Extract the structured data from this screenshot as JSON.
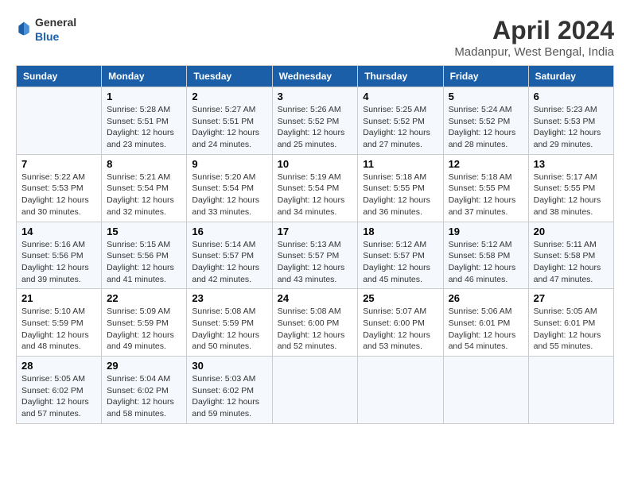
{
  "header": {
    "logo": {
      "text1": "General",
      "text2": "Blue"
    },
    "title": "April 2024",
    "subtitle": "Madanpur, West Bengal, India"
  },
  "calendar": {
    "columns": [
      "Sunday",
      "Monday",
      "Tuesday",
      "Wednesday",
      "Thursday",
      "Friday",
      "Saturday"
    ],
    "weeks": [
      {
        "days": [
          {
            "number": "",
            "info": ""
          },
          {
            "number": "1",
            "info": "Sunrise: 5:28 AM\nSunset: 5:51 PM\nDaylight: 12 hours\nand 23 minutes."
          },
          {
            "number": "2",
            "info": "Sunrise: 5:27 AM\nSunset: 5:51 PM\nDaylight: 12 hours\nand 24 minutes."
          },
          {
            "number": "3",
            "info": "Sunrise: 5:26 AM\nSunset: 5:52 PM\nDaylight: 12 hours\nand 25 minutes."
          },
          {
            "number": "4",
            "info": "Sunrise: 5:25 AM\nSunset: 5:52 PM\nDaylight: 12 hours\nand 27 minutes."
          },
          {
            "number": "5",
            "info": "Sunrise: 5:24 AM\nSunset: 5:52 PM\nDaylight: 12 hours\nand 28 minutes."
          },
          {
            "number": "6",
            "info": "Sunrise: 5:23 AM\nSunset: 5:53 PM\nDaylight: 12 hours\nand 29 minutes."
          }
        ]
      },
      {
        "days": [
          {
            "number": "7",
            "info": "Sunrise: 5:22 AM\nSunset: 5:53 PM\nDaylight: 12 hours\nand 30 minutes."
          },
          {
            "number": "8",
            "info": "Sunrise: 5:21 AM\nSunset: 5:54 PM\nDaylight: 12 hours\nand 32 minutes."
          },
          {
            "number": "9",
            "info": "Sunrise: 5:20 AM\nSunset: 5:54 PM\nDaylight: 12 hours\nand 33 minutes."
          },
          {
            "number": "10",
            "info": "Sunrise: 5:19 AM\nSunset: 5:54 PM\nDaylight: 12 hours\nand 34 minutes."
          },
          {
            "number": "11",
            "info": "Sunrise: 5:18 AM\nSunset: 5:55 PM\nDaylight: 12 hours\nand 36 minutes."
          },
          {
            "number": "12",
            "info": "Sunrise: 5:18 AM\nSunset: 5:55 PM\nDaylight: 12 hours\nand 37 minutes."
          },
          {
            "number": "13",
            "info": "Sunrise: 5:17 AM\nSunset: 5:55 PM\nDaylight: 12 hours\nand 38 minutes."
          }
        ]
      },
      {
        "days": [
          {
            "number": "14",
            "info": "Sunrise: 5:16 AM\nSunset: 5:56 PM\nDaylight: 12 hours\nand 39 minutes."
          },
          {
            "number": "15",
            "info": "Sunrise: 5:15 AM\nSunset: 5:56 PM\nDaylight: 12 hours\nand 41 minutes."
          },
          {
            "number": "16",
            "info": "Sunrise: 5:14 AM\nSunset: 5:57 PM\nDaylight: 12 hours\nand 42 minutes."
          },
          {
            "number": "17",
            "info": "Sunrise: 5:13 AM\nSunset: 5:57 PM\nDaylight: 12 hours\nand 43 minutes."
          },
          {
            "number": "18",
            "info": "Sunrise: 5:12 AM\nSunset: 5:57 PM\nDaylight: 12 hours\nand 45 minutes."
          },
          {
            "number": "19",
            "info": "Sunrise: 5:12 AM\nSunset: 5:58 PM\nDaylight: 12 hours\nand 46 minutes."
          },
          {
            "number": "20",
            "info": "Sunrise: 5:11 AM\nSunset: 5:58 PM\nDaylight: 12 hours\nand 47 minutes."
          }
        ]
      },
      {
        "days": [
          {
            "number": "21",
            "info": "Sunrise: 5:10 AM\nSunset: 5:59 PM\nDaylight: 12 hours\nand 48 minutes."
          },
          {
            "number": "22",
            "info": "Sunrise: 5:09 AM\nSunset: 5:59 PM\nDaylight: 12 hours\nand 49 minutes."
          },
          {
            "number": "23",
            "info": "Sunrise: 5:08 AM\nSunset: 5:59 PM\nDaylight: 12 hours\nand 50 minutes."
          },
          {
            "number": "24",
            "info": "Sunrise: 5:08 AM\nSunset: 6:00 PM\nDaylight: 12 hours\nand 52 minutes."
          },
          {
            "number": "25",
            "info": "Sunrise: 5:07 AM\nSunset: 6:00 PM\nDaylight: 12 hours\nand 53 minutes."
          },
          {
            "number": "26",
            "info": "Sunrise: 5:06 AM\nSunset: 6:01 PM\nDaylight: 12 hours\nand 54 minutes."
          },
          {
            "number": "27",
            "info": "Sunrise: 5:05 AM\nSunset: 6:01 PM\nDaylight: 12 hours\nand 55 minutes."
          }
        ]
      },
      {
        "days": [
          {
            "number": "28",
            "info": "Sunrise: 5:05 AM\nSunset: 6:02 PM\nDaylight: 12 hours\nand 57 minutes."
          },
          {
            "number": "29",
            "info": "Sunrise: 5:04 AM\nSunset: 6:02 PM\nDaylight: 12 hours\nand 58 minutes."
          },
          {
            "number": "30",
            "info": "Sunrise: 5:03 AM\nSunset: 6:02 PM\nDaylight: 12 hours\nand 59 minutes."
          },
          {
            "number": "",
            "info": ""
          },
          {
            "number": "",
            "info": ""
          },
          {
            "number": "",
            "info": ""
          },
          {
            "number": "",
            "info": ""
          }
        ]
      }
    ]
  }
}
